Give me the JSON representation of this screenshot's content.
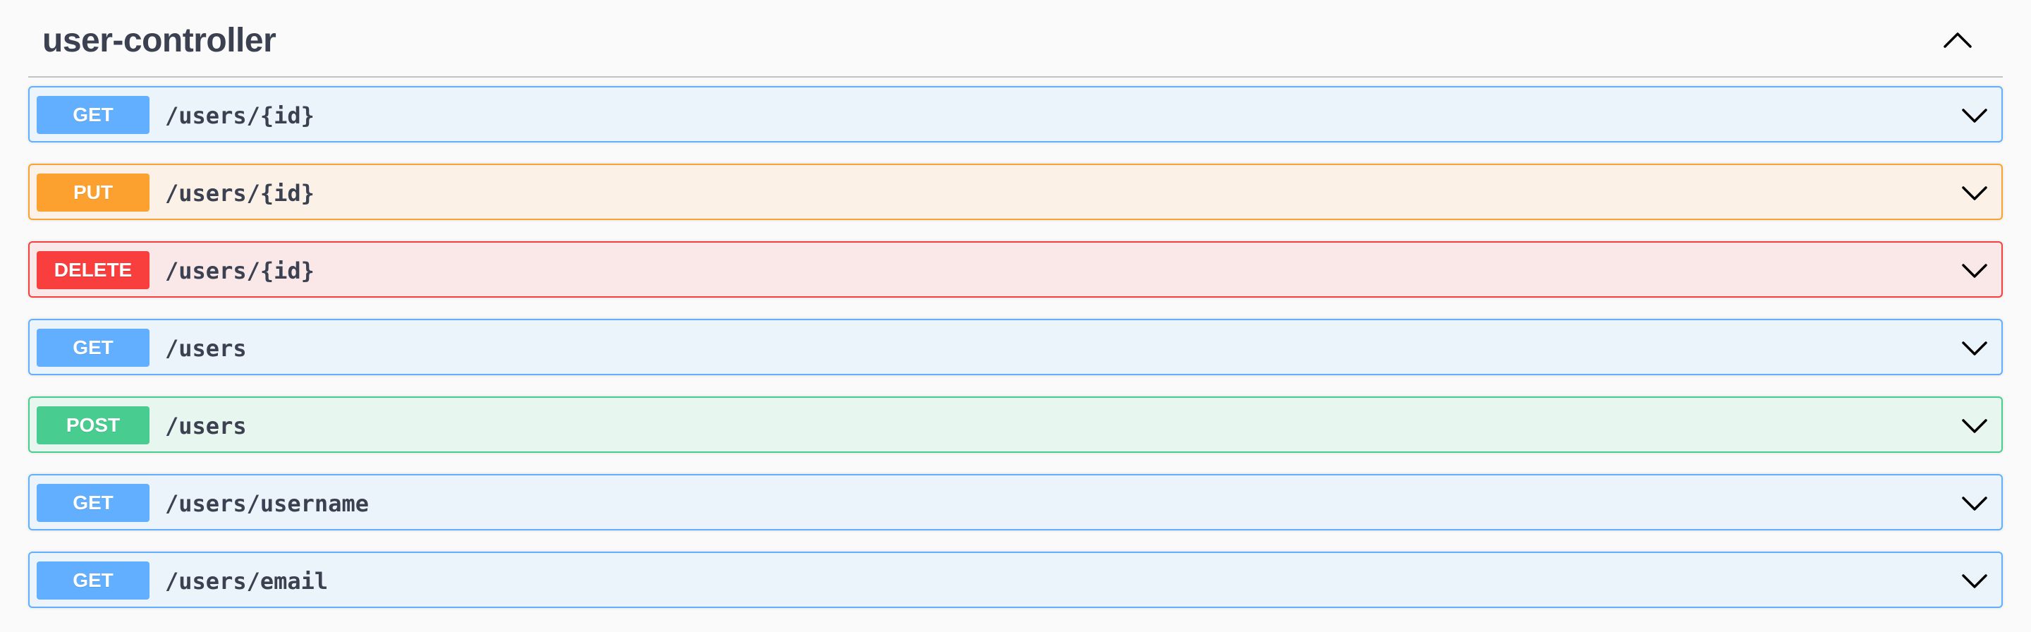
{
  "tag": {
    "title": "user-controller",
    "toggle_icon": "chevron-up-icon"
  },
  "colors": {
    "GET": {
      "badge": "#61affe",
      "background": "#ebf3fb",
      "border": "#61affe"
    },
    "PUT": {
      "badge": "#fca130",
      "background": "#fbf1e6",
      "border": "#fca130"
    },
    "DELETE": {
      "badge": "#f93e3e",
      "background": "#fae7e7",
      "border": "#f93e3e"
    },
    "POST": {
      "badge": "#49cc90",
      "background": "#e8f6f0",
      "border": "#49cc90"
    }
  },
  "operations": [
    {
      "method": "GET",
      "path": "/users/{id}"
    },
    {
      "method": "PUT",
      "path": "/users/{id}"
    },
    {
      "method": "DELETE",
      "path": "/users/{id}"
    },
    {
      "method": "GET",
      "path": "/users"
    },
    {
      "method": "POST",
      "path": "/users"
    },
    {
      "method": "GET",
      "path": "/users/username"
    },
    {
      "method": "GET",
      "path": "/users/email"
    }
  ],
  "expand_icon": "chevron-down-icon"
}
